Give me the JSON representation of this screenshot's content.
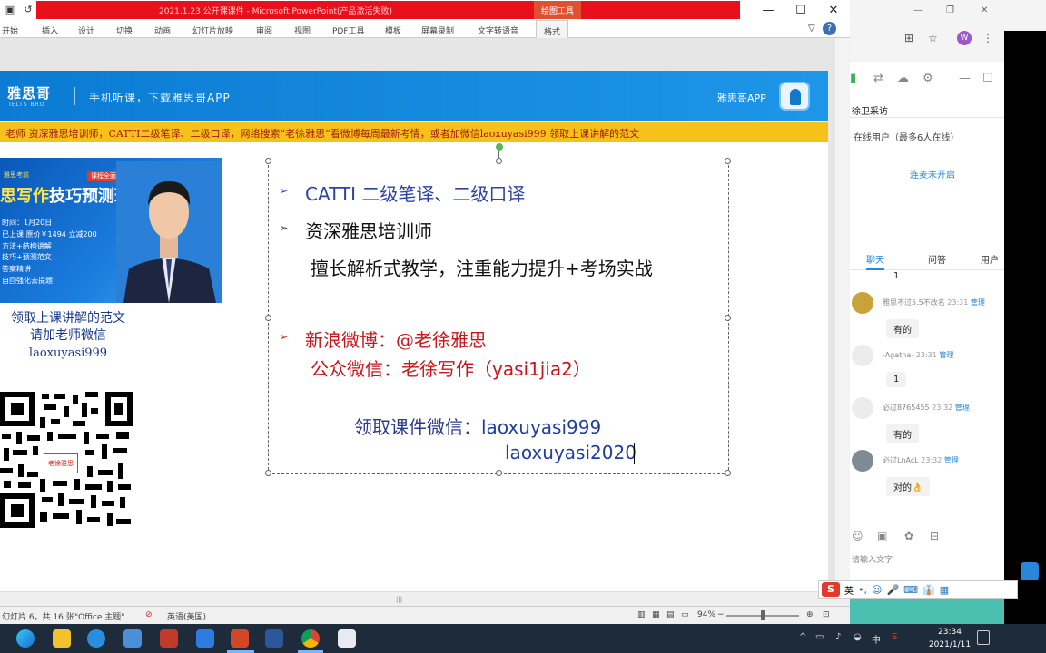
{
  "ppt": {
    "title": "2021.1.23 公开课课件 - Microsoft PowerPoint(产品激活失败)",
    "drawing_tools_tab": "绘图工具",
    "tabs": [
      "开始",
      "插入",
      "设计",
      "切换",
      "动画",
      "幻灯片放映",
      "审阅",
      "视图",
      "PDF工具",
      "模板",
      "屏幕录制",
      "文字转语音"
    ],
    "active_tab": "格式",
    "window_buttons": {
      "minimize": "—",
      "maximize": "☐",
      "close": "✕"
    }
  },
  "slide": {
    "brand": "雅思哥",
    "brand_sub": "IELTS BRO",
    "slogan": "手机听课，下载雅思哥APP",
    "app_label": "雅思哥APP",
    "banner": "老师 资深雅思培训师，CATTI二级笔译、二级口译，网络搜索“老徐雅思”看微博每周最新考情，或者加微信laoxuyasi999 领取上课讲解的范文",
    "promo": {
      "tag": "课程全面升级",
      "small": "雅思考前",
      "title_a": "思写作",
      "title_b": "技巧预测班",
      "lines": [
        "时间：1月20日",
        "已上课  原价￥1494 立减200",
        "方法+结构讲解",
        "技巧+预测范文",
        "答案精讲",
        "自回强化去提题"
      ]
    },
    "left_text": [
      "领取上课讲解的范文",
      "请加老师微信",
      "laoxuyasi999"
    ],
    "qr_badge": "老徐雅思",
    "textbox": {
      "line1": "CATTI 二级笔译、二级口译",
      "line2": "资深雅思培训师",
      "line3": "擅长解析式教学，注重能力提升+考场实战",
      "line4": "新浪微博：@老徐雅思",
      "line5_a": "公众微信：老徐写作（",
      "line5_b": "yasi1jia2",
      "line5_c": "）",
      "line6_label": "领取课件微信：",
      "line6_value": "laoxuyasi999",
      "line7": "laoxuyasi2020"
    }
  },
  "status": {
    "slide_info": "幻灯片 6，共 16 张",
    "theme": "\"Office 主题\"",
    "lang": "英语(美国)",
    "zoom": "94%",
    "zoom_fraction": 0.5
  },
  "chat": {
    "live_title": "徐卫采访",
    "online": "在线用户（最多6人在线）",
    "not_open": "连麦未开启",
    "tabs": [
      "聊天",
      "问答",
      "用户"
    ],
    "messages": [
      {
        "name": "",
        "time": "",
        "text": "1",
        "admin": ""
      },
      {
        "name": "雅思不过5.5不改名",
        "time": "23:31",
        "text": "有的",
        "admin": "管理"
      },
      {
        "name": "-Agatha-",
        "time": "23:31",
        "text": "1",
        "admin": "管理"
      },
      {
        "name": "必过8765455",
        "time": "23:32",
        "text": "有的",
        "admin": "管理"
      },
      {
        "name": "必过LnAcL",
        "time": "23:32",
        "text": "对的👌",
        "admin": "管理"
      }
    ],
    "input_placeholder": "请输入文字",
    "ime_label": "英"
  },
  "taskbar": {
    "time": "23:34",
    "date": "2021/1/11"
  }
}
